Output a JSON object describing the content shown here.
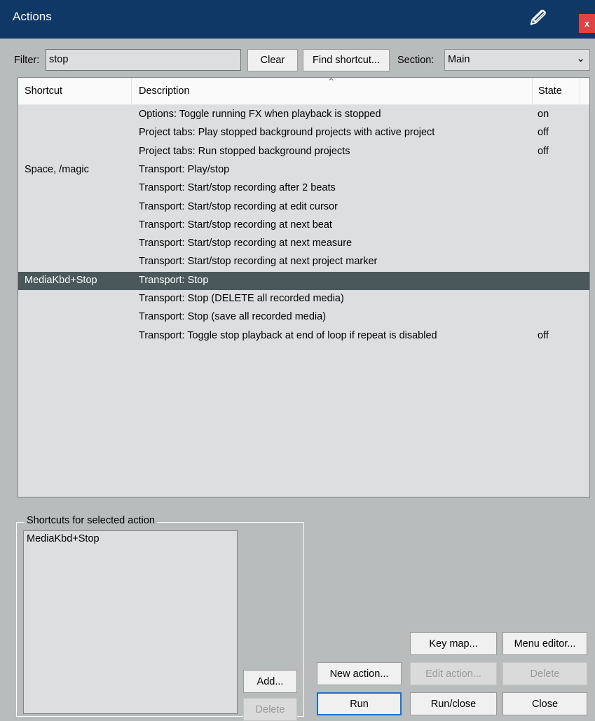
{
  "window": {
    "title": "Actions",
    "close_label": "x"
  },
  "filter": {
    "label": "Filter:",
    "value": "stop",
    "clear_label": "Clear",
    "find_shortcut_label": "Find shortcut...",
    "section_label": "Section:",
    "section_value": "Main"
  },
  "table": {
    "columns": [
      "Shortcut",
      "Description",
      "State"
    ],
    "rows": [
      {
        "shortcut": "",
        "description": "Options: Toggle running FX when playback is stopped",
        "state": "on"
      },
      {
        "shortcut": "",
        "description": "Project tabs: Play stopped background projects with active project",
        "state": "off"
      },
      {
        "shortcut": "",
        "description": "Project tabs: Run stopped background projects",
        "state": "off"
      },
      {
        "shortcut": "Space, /magic",
        "description": "Transport: Play/stop",
        "state": ""
      },
      {
        "shortcut": "",
        "description": "Transport: Start/stop recording after 2 beats",
        "state": ""
      },
      {
        "shortcut": "",
        "description": "Transport: Start/stop recording at edit cursor",
        "state": ""
      },
      {
        "shortcut": "",
        "description": "Transport: Start/stop recording at next beat",
        "state": ""
      },
      {
        "shortcut": "",
        "description": "Transport: Start/stop recording at next measure",
        "state": ""
      },
      {
        "shortcut": "",
        "description": "Transport: Start/stop recording at next project marker",
        "state": ""
      },
      {
        "shortcut": "MediaKbd+Stop",
        "description": "Transport: Stop",
        "state": "",
        "selected": true
      },
      {
        "shortcut": "",
        "description": "Transport: Stop (DELETE all recorded media)",
        "state": ""
      },
      {
        "shortcut": "",
        "description": "Transport: Stop (save all recorded media)",
        "state": ""
      },
      {
        "shortcut": "",
        "description": "Transport: Toggle stop playback at end of loop if repeat is disabled",
        "state": "off"
      }
    ]
  },
  "shortcuts_panel": {
    "title": "Shortcuts for selected action",
    "items": [
      "MediaKbd+Stop"
    ],
    "add_label": "Add...",
    "delete_label": "Delete"
  },
  "buttons": {
    "key_map": "Key map...",
    "menu_editor": "Menu editor...",
    "new_action": "New action...",
    "edit_action": "Edit action...",
    "delete": "Delete",
    "run": "Run",
    "run_close": "Run/close",
    "close": "Close"
  },
  "colors": {
    "titlebar": "#0f3866",
    "selected_row": "#4a585c",
    "list_background": "#dcdedf",
    "window_background": "#b9bcbc"
  }
}
